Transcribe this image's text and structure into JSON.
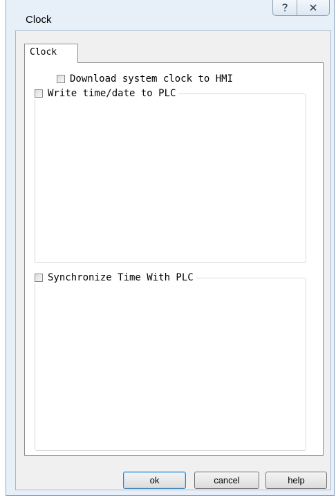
{
  "window": {
    "title": "Clock",
    "help_glyph": "?",
    "close_glyph": "✕"
  },
  "tabs": [
    {
      "label": "Clock",
      "active": true
    }
  ],
  "options": {
    "download_clock": {
      "label": "Download system clock to HMI",
      "checked": false
    },
    "write_time": {
      "label": "Write time/date to PLC",
      "checked": false
    },
    "sync_time": {
      "label": "Synchronize Time With PLC",
      "checked": false
    }
  },
  "buttons": {
    "ok": "ok",
    "cancel": "cancel",
    "help": "help"
  },
  "colors": {
    "frame": "#e7f0f9",
    "client": "#f0f0f0",
    "default_button_border": "#3c7fb1"
  }
}
